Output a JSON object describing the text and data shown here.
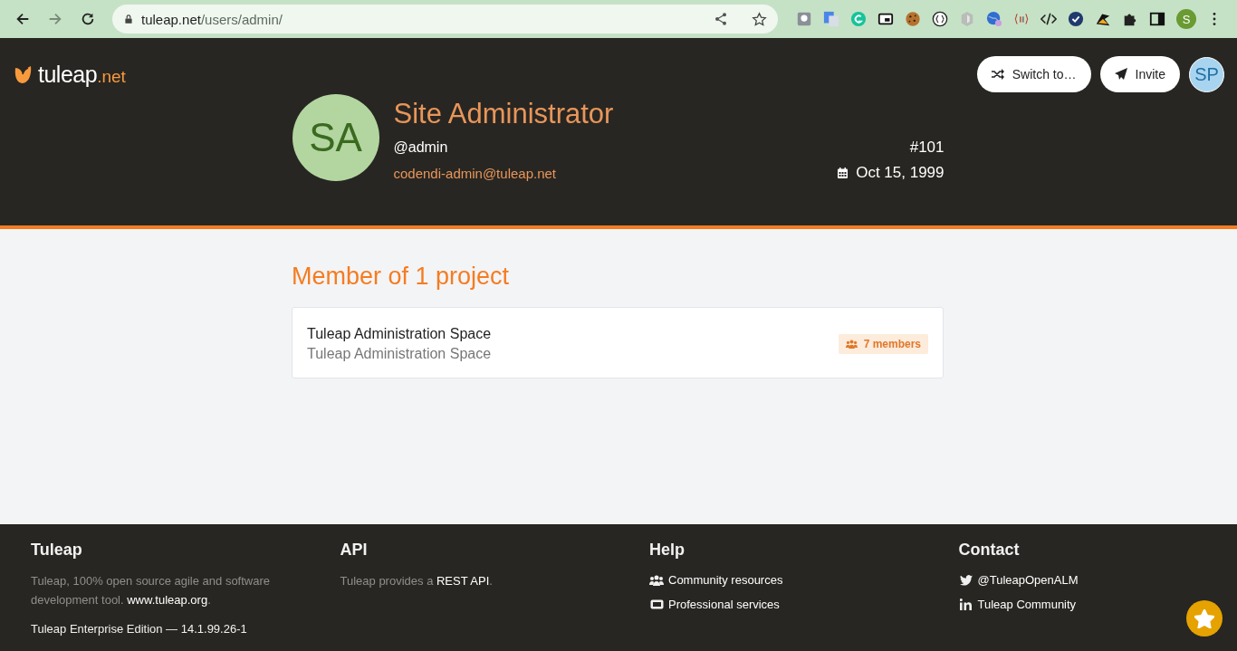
{
  "browser": {
    "url_host": "tuleap.net",
    "url_path": "/users/admin/",
    "profile_initial": "S"
  },
  "header": {
    "logo": {
      "name": "tuleap",
      "suffix": ".net"
    },
    "buttons": [
      {
        "kind": "switch",
        "label": "Switch to…"
      },
      {
        "kind": "invite",
        "label": "Invite"
      }
    ],
    "user_avatar": "SP"
  },
  "profile": {
    "initials": "SA",
    "name": "Site Administrator",
    "username": "@admin",
    "email": "codendi-admin@tuleap.net",
    "id": "#101",
    "date": "Oct 15, 1999"
  },
  "projects": {
    "title": "Member of 1 project",
    "items": [
      {
        "name": "Tuleap Administration Space",
        "description": "Tuleap Administration Space",
        "members": "7 members"
      }
    ]
  },
  "footer": {
    "columns": [
      {
        "title": "Tuleap",
        "paragraphs": [
          {
            "text": "Tuleap, 100% open source agile and software development tool. ",
            "link": "www.tuleap.org",
            "after": "."
          }
        ],
        "version": "Tuleap Enterprise Edition — 14.1.99.26-1"
      },
      {
        "title": "API",
        "paragraphs": [
          {
            "text": "Tuleap provides a ",
            "link": "REST API",
            "after": "."
          }
        ]
      },
      {
        "title": "Help",
        "links": [
          {
            "kind": "users",
            "label": "Community resources"
          },
          {
            "kind": "ticket",
            "label": "Professional services"
          }
        ]
      },
      {
        "title": "Contact",
        "links": [
          {
            "kind": "twitter",
            "label": "@TuleapOpenALM"
          },
          {
            "kind": "linkedin",
            "label": "Tuleap Community"
          }
        ]
      }
    ]
  }
}
